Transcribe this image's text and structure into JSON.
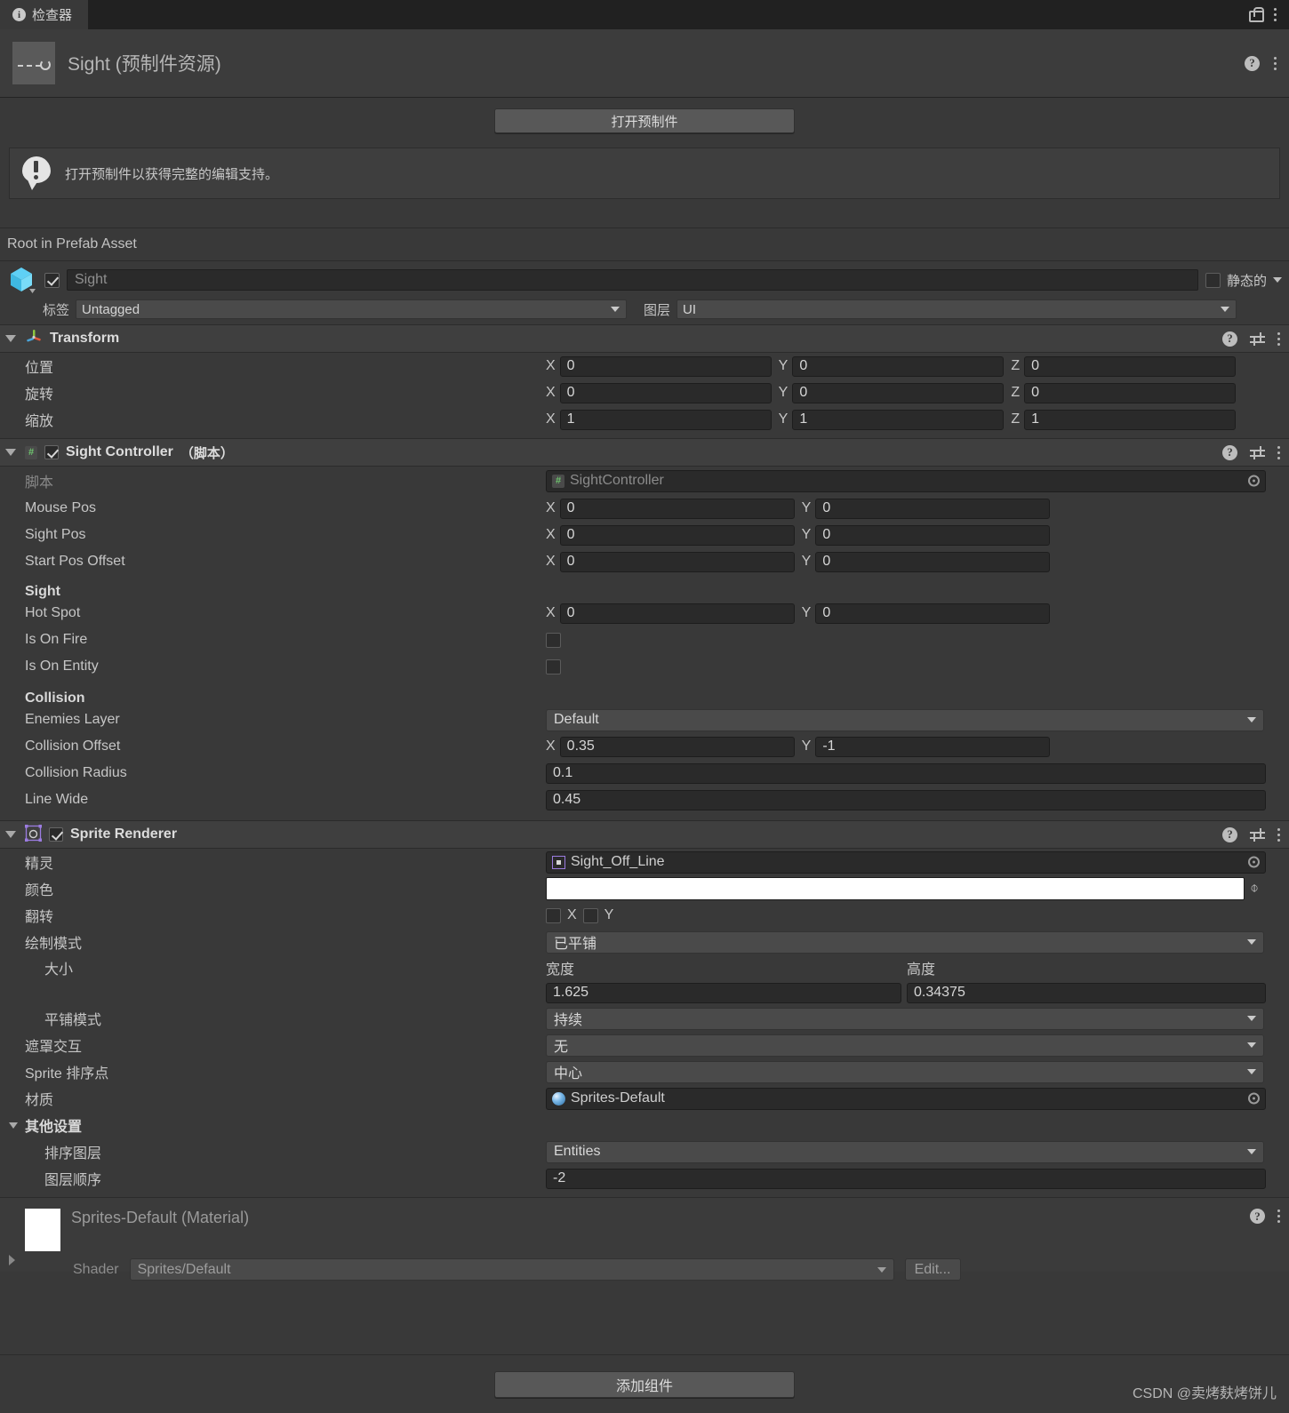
{
  "window": {
    "tab_label": "检查器",
    "tab_icon": "info-icon",
    "lock_icon": "lock-icon",
    "menu_icon": "kebab-menu-icon"
  },
  "asset": {
    "title": "Sight",
    "type_suffix": "(预制件资源)",
    "help_icon": "help-icon",
    "menu_icon": "kebab-menu-icon"
  },
  "open_prefab_button": "打开预制件",
  "info_banner": {
    "icon": "warning-bubble-icon",
    "text": "打开预制件以获得完整的编辑支持。"
  },
  "root_strip": "Root in Prefab Asset",
  "gameobject": {
    "enabled": true,
    "name": "Sight",
    "static_label": "静态的",
    "tag_label": "标签",
    "tag_value": "Untagged",
    "layer_label": "图层",
    "layer_value": "UI"
  },
  "components": [
    {
      "id": "transform",
      "title": "Transform",
      "icon": "transform-axis-icon",
      "rows": [
        {
          "label": "位置",
          "axes": [
            {
              "axis": "X",
              "value": "0"
            },
            {
              "axis": "Y",
              "value": "0"
            },
            {
              "axis": "Z",
              "value": "0"
            }
          ]
        },
        {
          "label": "旋转",
          "axes": [
            {
              "axis": "X",
              "value": "0"
            },
            {
              "axis": "Y",
              "value": "0"
            },
            {
              "axis": "Z",
              "value": "0"
            }
          ]
        },
        {
          "label": "缩放",
          "axes": [
            {
              "axis": "X",
              "value": "1"
            },
            {
              "axis": "Y",
              "value": "1"
            },
            {
              "axis": "Z",
              "value": "1"
            }
          ]
        }
      ]
    }
  ],
  "sight_controller": {
    "title": "Sight Controller",
    "suffix": "（脚本）",
    "enabled": true,
    "icon": "script-icon",
    "script_label": "脚本",
    "script_value": "SightController",
    "mouse_pos": {
      "label": "Mouse Pos",
      "x": "0",
      "y": "0"
    },
    "sight_pos": {
      "label": "Sight Pos",
      "x": "0",
      "y": "0"
    },
    "start_pos_offset": {
      "label": "Start Pos Offset",
      "x": "0",
      "y": "0"
    },
    "sight_group_header": "Sight",
    "hot_spot": {
      "label": "Hot Spot",
      "x": "0",
      "y": "0"
    },
    "is_on_fire": {
      "label": "Is On Fire",
      "checked": false
    },
    "is_on_entity": {
      "label": "Is On Entity",
      "checked": false
    },
    "collision_group_header": "Collision",
    "enemies_layer": {
      "label": "Enemies Layer",
      "value": "Default"
    },
    "collision_offset": {
      "label": "Collision Offset",
      "x": "0.35",
      "y": "-1"
    },
    "collision_radius": {
      "label": "Collision Radius",
      "value": "0.1"
    },
    "line_wide": {
      "label": "Line Wide",
      "value": "0.45"
    }
  },
  "sprite_renderer": {
    "title": "Sprite Renderer",
    "enabled": true,
    "icon": "sprite-renderer-icon",
    "sprite": {
      "label": "精灵",
      "value": "Sight_Off_Line"
    },
    "color": {
      "label": "颜色",
      "value": "#FFFFFF"
    },
    "flip": {
      "label": "翻转",
      "x_label": "X",
      "y_label": "Y",
      "x": false,
      "y": false
    },
    "draw_mode": {
      "label": "绘制模式",
      "value": "已平铺"
    },
    "size": {
      "label": "大小",
      "width_label": "宽度",
      "height_label": "高度",
      "width": "1.625",
      "height": "0.34375"
    },
    "tile_mode": {
      "label": "平铺模式",
      "value": "持续"
    },
    "mask_interaction": {
      "label": "遮罩交互",
      "value": "无"
    },
    "sprite_sort_point": {
      "label": "Sprite 排序点",
      "value": "中心"
    },
    "material": {
      "label": "材质",
      "value": "Sprites-Default"
    },
    "other_settings": {
      "label": "其他设置"
    },
    "sorting_layer": {
      "label": "排序图层",
      "value": "Entities"
    },
    "order_in_layer": {
      "label": "图层顺序",
      "value": "-2"
    }
  },
  "material_block": {
    "title": "Sprites-Default (Material)",
    "shader_label": "Shader",
    "shader_value": "Sprites/Default",
    "edit_button": "Edit...",
    "help_icon": "help-icon",
    "menu_icon": "kebab-menu-icon"
  },
  "footer": {
    "add_component_button": "添加组件",
    "watermark": "CSDN @卖烤麸烤饼儿"
  }
}
